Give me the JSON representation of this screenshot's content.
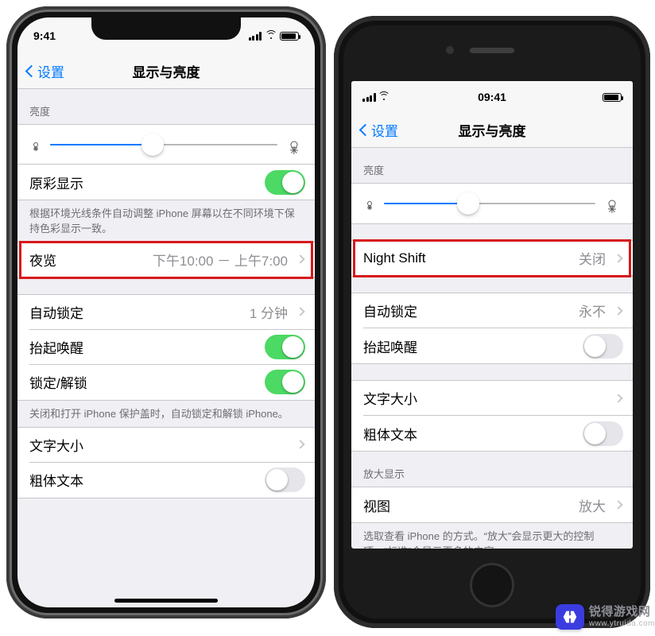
{
  "phoneX": {
    "statusbar": {
      "time": "9:41"
    },
    "nav": {
      "back": "设置",
      "title": "显示与亮度"
    },
    "brightness": {
      "header": "亮度",
      "value_pct": 45
    },
    "trueTone": {
      "label": "原彩显示",
      "on": true,
      "footer": "根据环境光线条件自动调整 iPhone 屏幕以在不同环境下保持色彩显示一致。"
    },
    "nightShift": {
      "label": "夜览",
      "value": "下午10:00 － 上午7:00"
    },
    "autoLock": {
      "label": "自动锁定",
      "value": "1 分钟"
    },
    "raiseToWake": {
      "label": "抬起唤醒",
      "on": true
    },
    "lockUnlock": {
      "label": "锁定/解锁",
      "on": true,
      "footer": "关闭和打开 iPhone 保护盖时，自动锁定和解锁 iPhone。"
    },
    "textSize": {
      "label": "文字大小"
    },
    "boldText": {
      "label": "粗体文本",
      "on": false
    }
  },
  "phone8": {
    "statusbar": {
      "time": "09:41"
    },
    "nav": {
      "back": "设置",
      "title": "显示与亮度"
    },
    "brightness": {
      "header": "亮度",
      "value_pct": 40
    },
    "nightShift": {
      "label": "Night Shift",
      "value": "关闭"
    },
    "autoLock": {
      "label": "自动锁定",
      "value": "永不"
    },
    "raiseToWake": {
      "label": "抬起唤醒",
      "on": false
    },
    "textSize": {
      "label": "文字大小"
    },
    "boldText": {
      "label": "粗体文本",
      "on": false
    },
    "zoom": {
      "header": "放大显示",
      "label": "视图",
      "value": "放大",
      "footer": "选取查看 iPhone 的方式。“放大”会显示更大的控制项。“标准”会显示更多的内容。"
    }
  },
  "watermark": {
    "line1": "锐得游戏网",
    "line2": "www.ytruida.com"
  }
}
